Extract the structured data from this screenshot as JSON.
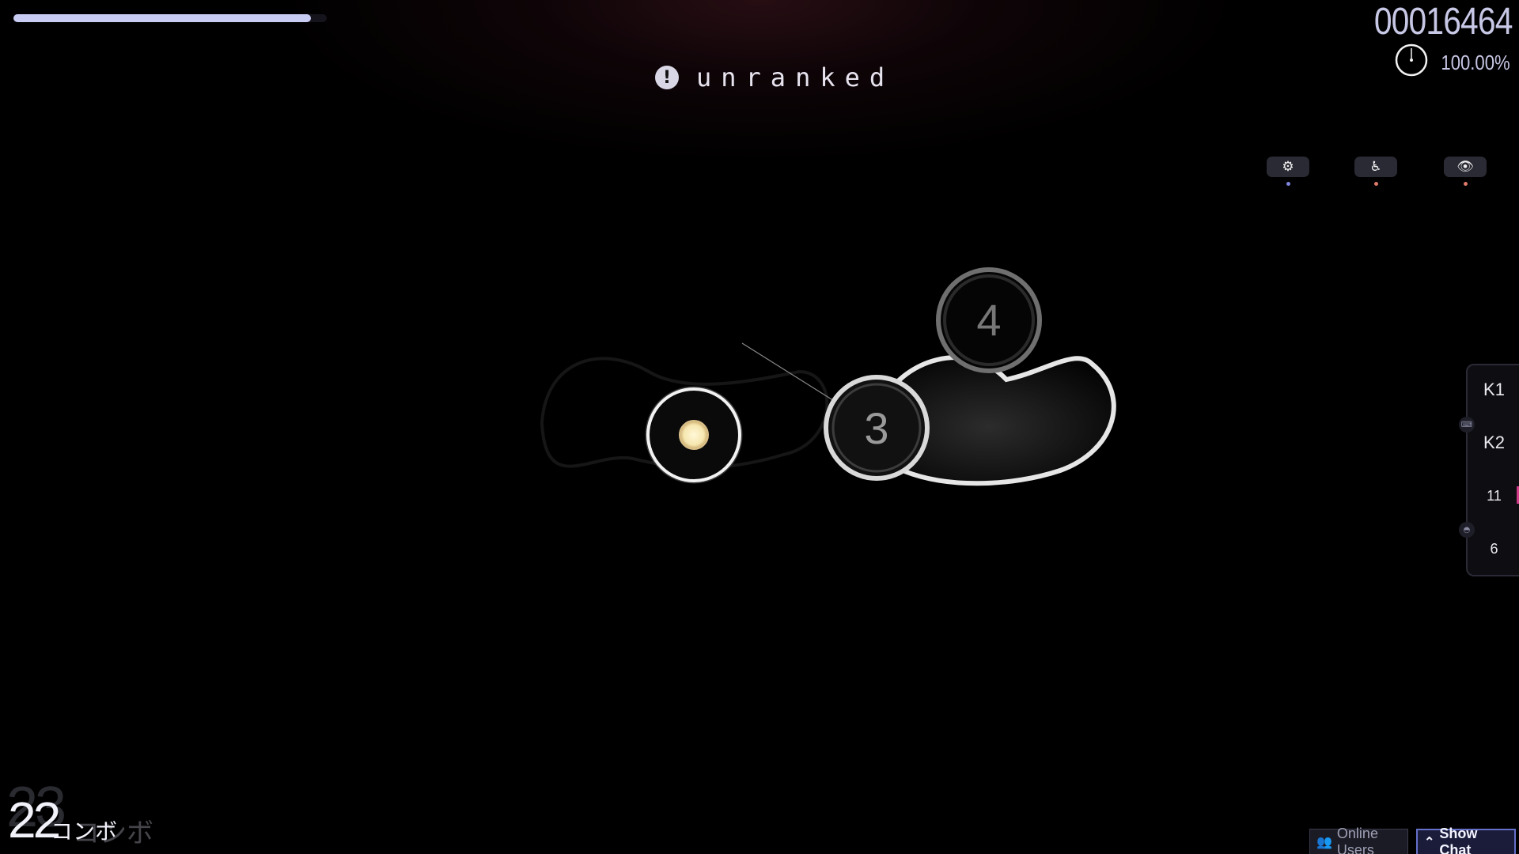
{
  "progress": {
    "fraction": 0.95
  },
  "banner": {
    "icon": "exclamation-icon",
    "icon_glyph": "!",
    "label": "unranked"
  },
  "score": {
    "value": "00016464",
    "accuracy": "100.00%"
  },
  "mods": [
    {
      "name": "settings-gear-icon",
      "glyph": "⚙",
      "dot_color": "#7d86e0"
    },
    {
      "name": "autopilot-accessibility-icon",
      "glyph": "♿",
      "dot_color": "#e07a6a"
    },
    {
      "name": "hidden-eye-icon",
      "glyph": "👁",
      "dot_color": "#e07a6a"
    }
  ],
  "hit_objects": {
    "circle_3": {
      "number": "3"
    },
    "circle_4": {
      "number": "4"
    }
  },
  "key_overlay": {
    "k1": {
      "label": "K1",
      "count": "11"
    },
    "k2": {
      "label": "K2",
      "count": "6"
    },
    "keyboard_icon": "keyboard-icon",
    "mouse_icon": "mouse-icon"
  },
  "combo": {
    "current": "22",
    "previous": "23",
    "suffix": "コンボ",
    "suffix_ghost": "コンボ"
  },
  "bottom_buttons": {
    "online_users": {
      "label": "Online Users",
      "icon": "users-icon"
    },
    "show_chat": {
      "label": "Show Chat",
      "icon": "chevron-up-icon"
    }
  },
  "colors": {
    "accent": "#c9ccf2",
    "text": "#e7e3ee",
    "chat_border": "#6570c8"
  }
}
